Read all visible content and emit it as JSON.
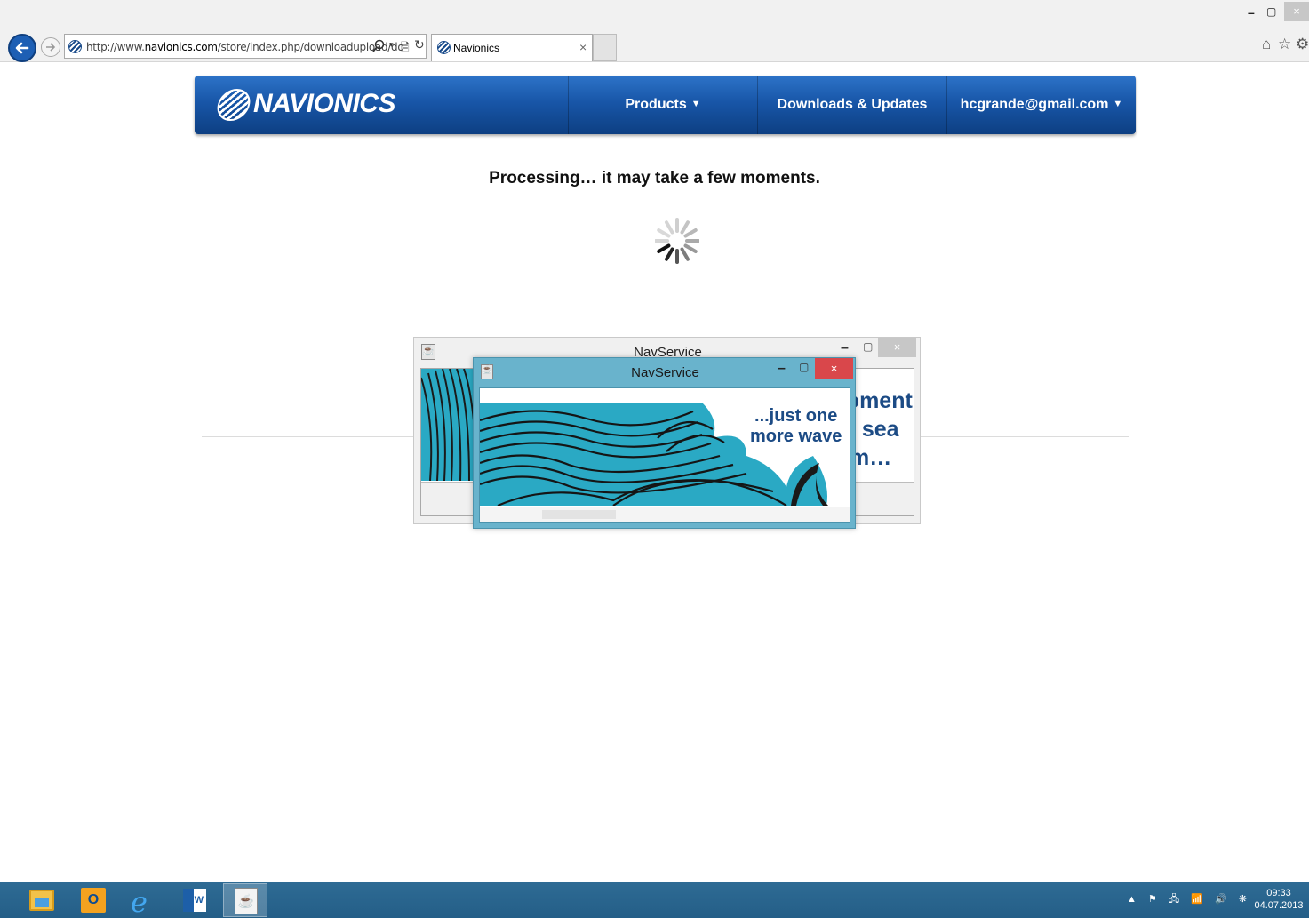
{
  "browser": {
    "url_prefix": "http://www.",
    "url_domain": "navionics.com",
    "url_path": "/store/index.php/downloadupload/do",
    "tab_title": "Navionics",
    "tab_close": "×",
    "window_min": "–",
    "window_max": "▢",
    "window_close": "×",
    "home_icon": "⌂",
    "favorites_icon": "☆",
    "tools_icon": "⚙",
    "compat_icon": "🗎",
    "refresh_icon": "↻",
    "dropdown_icon": "▾"
  },
  "header": {
    "logo": "NAVIONICS",
    "nav": [
      {
        "label": "Products",
        "caret": "▼"
      },
      {
        "label": "Downloads & Updates",
        "caret": ""
      },
      {
        "label": "hcgrande@gmail.com",
        "caret": "▼"
      }
    ]
  },
  "main": {
    "status": "Processing… it may take a few moments."
  },
  "dialogs": [
    {
      "title": "NavService",
      "message": [
        "One moment",
        "and the sea",
        "will calm…"
      ],
      "min": "–",
      "max": "▢",
      "close": "×"
    },
    {
      "title": "NavService",
      "message": [
        "...just one",
        "more wave"
      ],
      "min": "–",
      "max": "▢",
      "close": "×",
      "progress": 0.2
    }
  ],
  "taskbar": {
    "apps": [
      "file-explorer",
      "outlook",
      "internet-explorer",
      "word",
      "java"
    ],
    "outlook_label": "O",
    "ie_label": "e",
    "word_label": "W",
    "java_label": "☕",
    "tray": [
      "▲",
      "⚑",
      "🖧",
      "📶",
      "🔊",
      "❋"
    ],
    "time": "09:33",
    "date": "04.07.2013"
  },
  "colors": {
    "header_blue": "#1856a8",
    "dialog_frame": "#69b3cc",
    "dialog_close": "#d9474b",
    "wave_teal": "#2aa9c4",
    "taskbar": "#2a6590"
  }
}
